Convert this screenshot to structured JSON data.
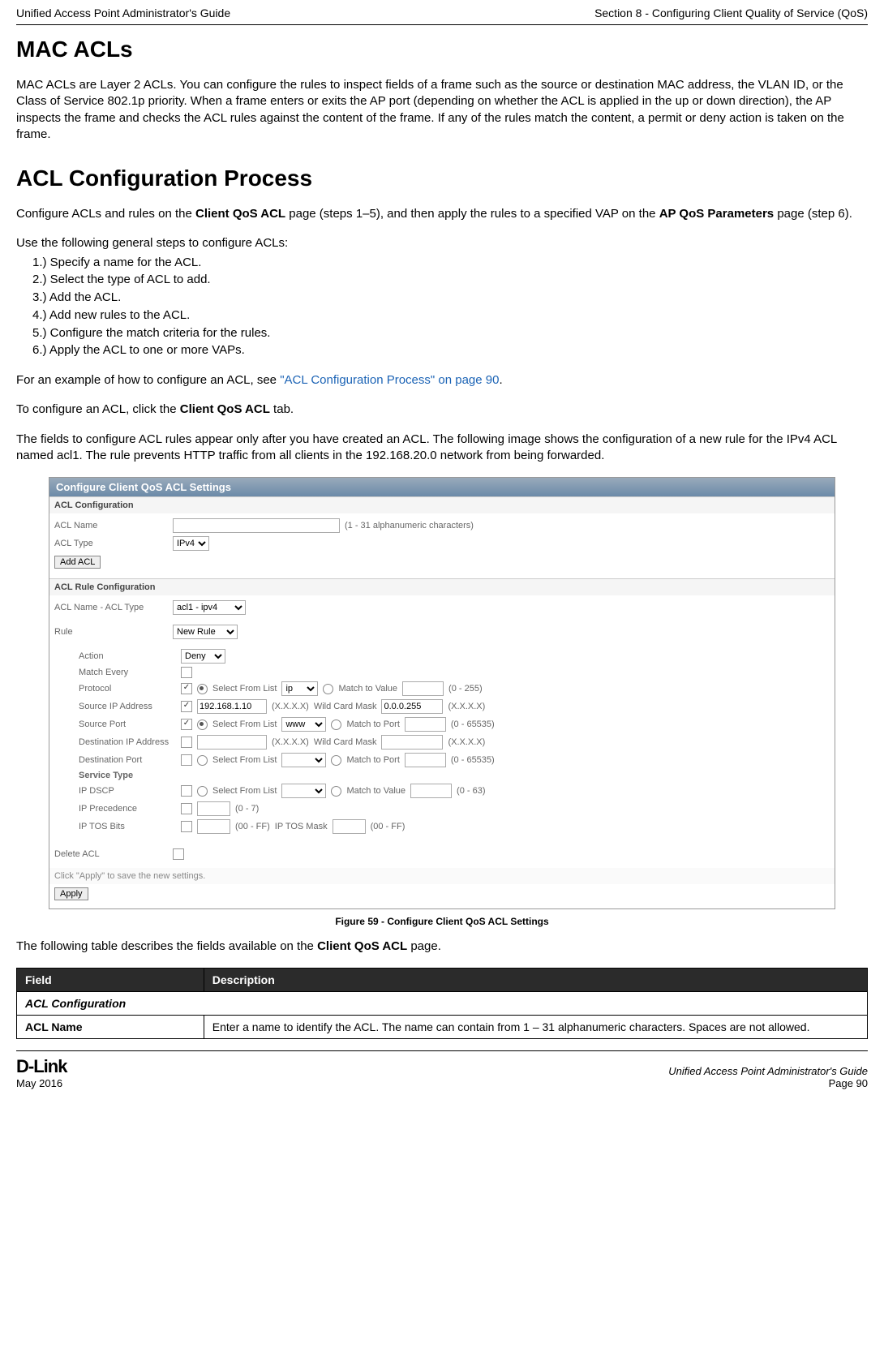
{
  "header": {
    "left": "Unified Access Point Administrator's Guide",
    "right": "Section 8 - Configuring Client Quality of Service (QoS)"
  },
  "headings": {
    "mac_acls": "MAC ACLs",
    "acl_config_process": "ACL Configuration Process"
  },
  "paragraphs": {
    "mac_acls_intro": "MAC ACLs are Layer 2 ACLs. You can configure the rules to inspect fields of a frame such as the source or destination MAC address, the VLAN ID, or the Class of Service 802.1p priority. When a frame enters or exits the AP port (depending on whether the ACL is applied in the up or down direction), the AP inspects the frame and checks the ACL rules against the content of the frame. If any of the rules match the content, a permit or deny action is taken on the frame.",
    "acl_process_intro_pre": "Configure ACLs and rules on the ",
    "acl_process_intro_bold1": "Client QoS ACL",
    "acl_process_intro_mid": " page (steps 1–5), and then apply the rules to a specified VAP on the ",
    "acl_process_intro_bold2": "AP QoS Parameters",
    "acl_process_intro_post": " page (step 6).",
    "use_steps": "Use the following general steps to configure ACLs:",
    "example_pre": "For an example of how to configure an ACL, see ",
    "example_link": "\"ACL Configuration Process\" on page 90",
    "example_post": ".",
    "to_configure_pre": "To configure an ACL, click the ",
    "to_configure_bold": "Client QoS ACL",
    "to_configure_post": " tab.",
    "fields_desc": "The fields to configure ACL rules appear only after you have created an ACL. The following image shows the configuration of a new rule for the IPv4 ACL named acl1. The rule prevents HTTP traffic from all clients in the 192.168.20.0 network from being forwarded.",
    "table_intro_pre": "The following table describes the fields available on the ",
    "table_intro_bold": "Client QoS ACL",
    "table_intro_post": " page."
  },
  "steps": [
    "1.)  Specify a name for the ACL.",
    "2.)  Select the type of ACL to add.",
    "3.)  Add the ACL.",
    "4.)  Add new rules to the ACL.",
    "5.)  Configure the match criteria for the rules.",
    "6.)  Apply the ACL to one or more VAPs."
  ],
  "figure": {
    "title_bar": "Configure Client QoS ACL Settings",
    "section_acl_config": "ACL Configuration",
    "acl_name_label": "ACL Name",
    "acl_name_hint": "(1 - 31 alphanumeric characters)",
    "acl_type_label": "ACL Type",
    "acl_type_value": "IPv4",
    "add_acl_btn": "Add ACL",
    "section_rule_config": "ACL Rule Configuration",
    "acl_name_type_label": "ACL Name - ACL Type",
    "acl_name_type_value": "acl1 - ipv4",
    "rule_label": "Rule",
    "rule_value": "New Rule",
    "rows": {
      "action": {
        "label": "Action",
        "value": "Deny"
      },
      "match_every": {
        "label": "Match Every"
      },
      "protocol": {
        "label": "Protocol",
        "sel_list": "Select From List",
        "list_val": "ip",
        "match_val": "Match to Value",
        "range": "(0 - 255)"
      },
      "src_ip": {
        "label": "Source IP Address",
        "ip": "192.168.1.10",
        "fmt": "(X.X.X.X)",
        "mask_label": "Wild Card Mask",
        "mask": "0.0.0.255",
        "mask_fmt": "(X.X.X.X)"
      },
      "src_port": {
        "label": "Source Port",
        "sel_list": "Select From List",
        "list_val": "www",
        "match_port": "Match to Port",
        "range": "(0 - 65535)"
      },
      "dst_ip": {
        "label": "Destination IP Address",
        "fmt": "(X.X.X.X)",
        "mask_label": "Wild Card Mask",
        "mask_fmt": "(X.X.X.X)"
      },
      "dst_port": {
        "label": "Destination Port",
        "sel_list": "Select From List",
        "match_port": "Match to Port",
        "range": "(0 - 65535)"
      },
      "service_type": {
        "label": "Service Type"
      },
      "ip_dscp": {
        "label": "IP DSCP",
        "sel_list": "Select From List",
        "match_val": "Match to Value",
        "range": "(0 - 63)"
      },
      "ip_prec": {
        "label": "IP Precedence",
        "range": "(0 - 7)"
      },
      "ip_tos": {
        "label": "IP TOS Bits",
        "range1": "(00 - FF)",
        "mask_label": "IP TOS Mask",
        "range2": "(00 - FF)"
      }
    },
    "delete_acl": "Delete ACL",
    "apply_hint": "Click \"Apply\" to save the new settings.",
    "apply_btn": "Apply",
    "caption": "Figure 59 - Configure Client QoS ACL Settings"
  },
  "table": {
    "head_field": "Field",
    "head_desc": "Description",
    "sub_acl_config": "ACL Configuration",
    "acl_name_field": "ACL Name",
    "acl_name_desc": "Enter a name to identify the ACL. The name can contain from 1 – 31 alphanumeric characters. Spaces are not allowed."
  },
  "footer": {
    "logo": "D-Link",
    "date": "May 2016",
    "right_title": "Unified Access Point Administrator's Guide",
    "page": "Page 90"
  }
}
